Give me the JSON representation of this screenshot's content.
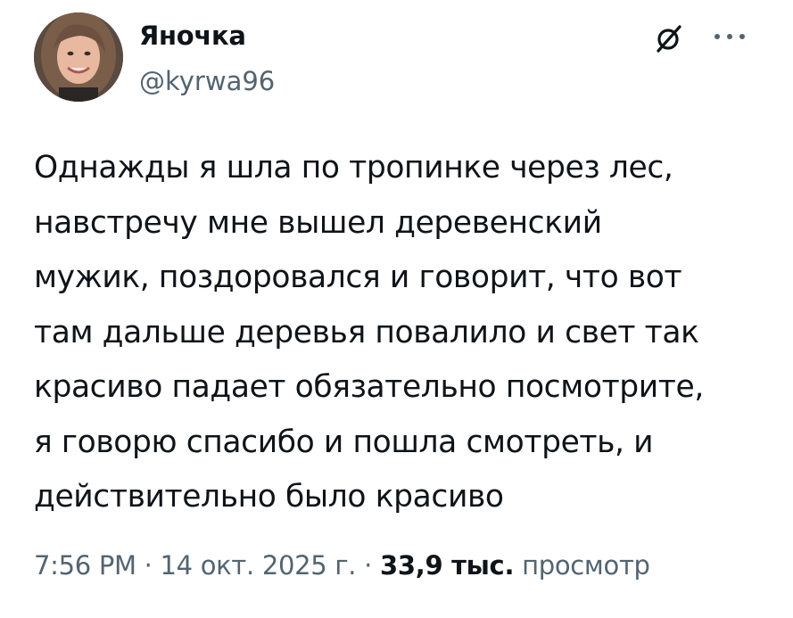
{
  "author": {
    "display_name": "Яночка",
    "handle": "@kyrwa96"
  },
  "header_actions": {
    "grok_icon": "grok-slash-circle-icon",
    "more_icon": "more-horizontal-icon"
  },
  "tweet": {
    "lines": [
      "Однажды я шла по тропинке через лес,",
      "навстречу мне вышел деревенский",
      "мужик, поздоровался и говорит, что вот",
      "там дальше деревья повалило и свет так",
      "красиво падает обязательно посмотрите,",
      "я говорю спасибо и пошла смотреть, и",
      "действительно было красиво"
    ]
  },
  "meta": {
    "time": "7:56 PM",
    "separator": " · ",
    "date": "14 окт. 2025 г.",
    "views_count": "33,9 тыс.",
    "views_label": "просмотр"
  },
  "colors": {
    "text_primary": "#0f1419",
    "text_secondary": "#536471",
    "background": "#ffffff"
  }
}
